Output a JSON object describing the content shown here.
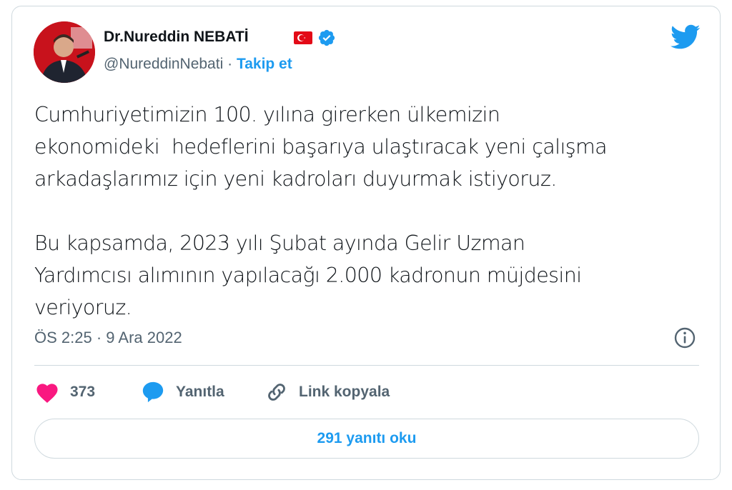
{
  "author": {
    "name": "Dr.Nureddin NEBATİ",
    "handle": "@NureddinNebati",
    "separator": "·",
    "follow_label": "Takip et"
  },
  "icons": {
    "avatar": "profile-photo",
    "flag": "turkey-flag-icon",
    "verified": "verified-badge-icon",
    "logo": "twitter-bird-icon",
    "info": "info-icon",
    "like": "heart-icon",
    "reply": "speech-bubble-icon",
    "link": "link-icon"
  },
  "tweet": {
    "paragraph1": "Cumhuriyetimizin 100. yılına girerken ülkemizin\nekonomideki  hedeflerini başarıya ulaştıracak yeni çalışma\narkadaşlarımız için yeni kadroları duyurmak istiyoruz.",
    "paragraph2": "Bu kapsamda, 2023 yılı Şubat ayında Gelir Uzman\nYardımcısı alımının yapılacağı 2.000 kadronun müjdesini\nveriyoruz."
  },
  "timestamp": "ÖS 2:25 · 9 Ara 2022",
  "actions": {
    "likes_count": "373",
    "reply_label": "Yanıtla",
    "copy_link_label": "Link kopyala"
  },
  "read_replies_label": "291 yanıtı oku",
  "colors": {
    "accent": "#1d9bf0",
    "like": "#f91880",
    "text": "#0f1419",
    "secondary": "#536471",
    "border": "#cfd9de",
    "flag_red": "#e30a17"
  }
}
